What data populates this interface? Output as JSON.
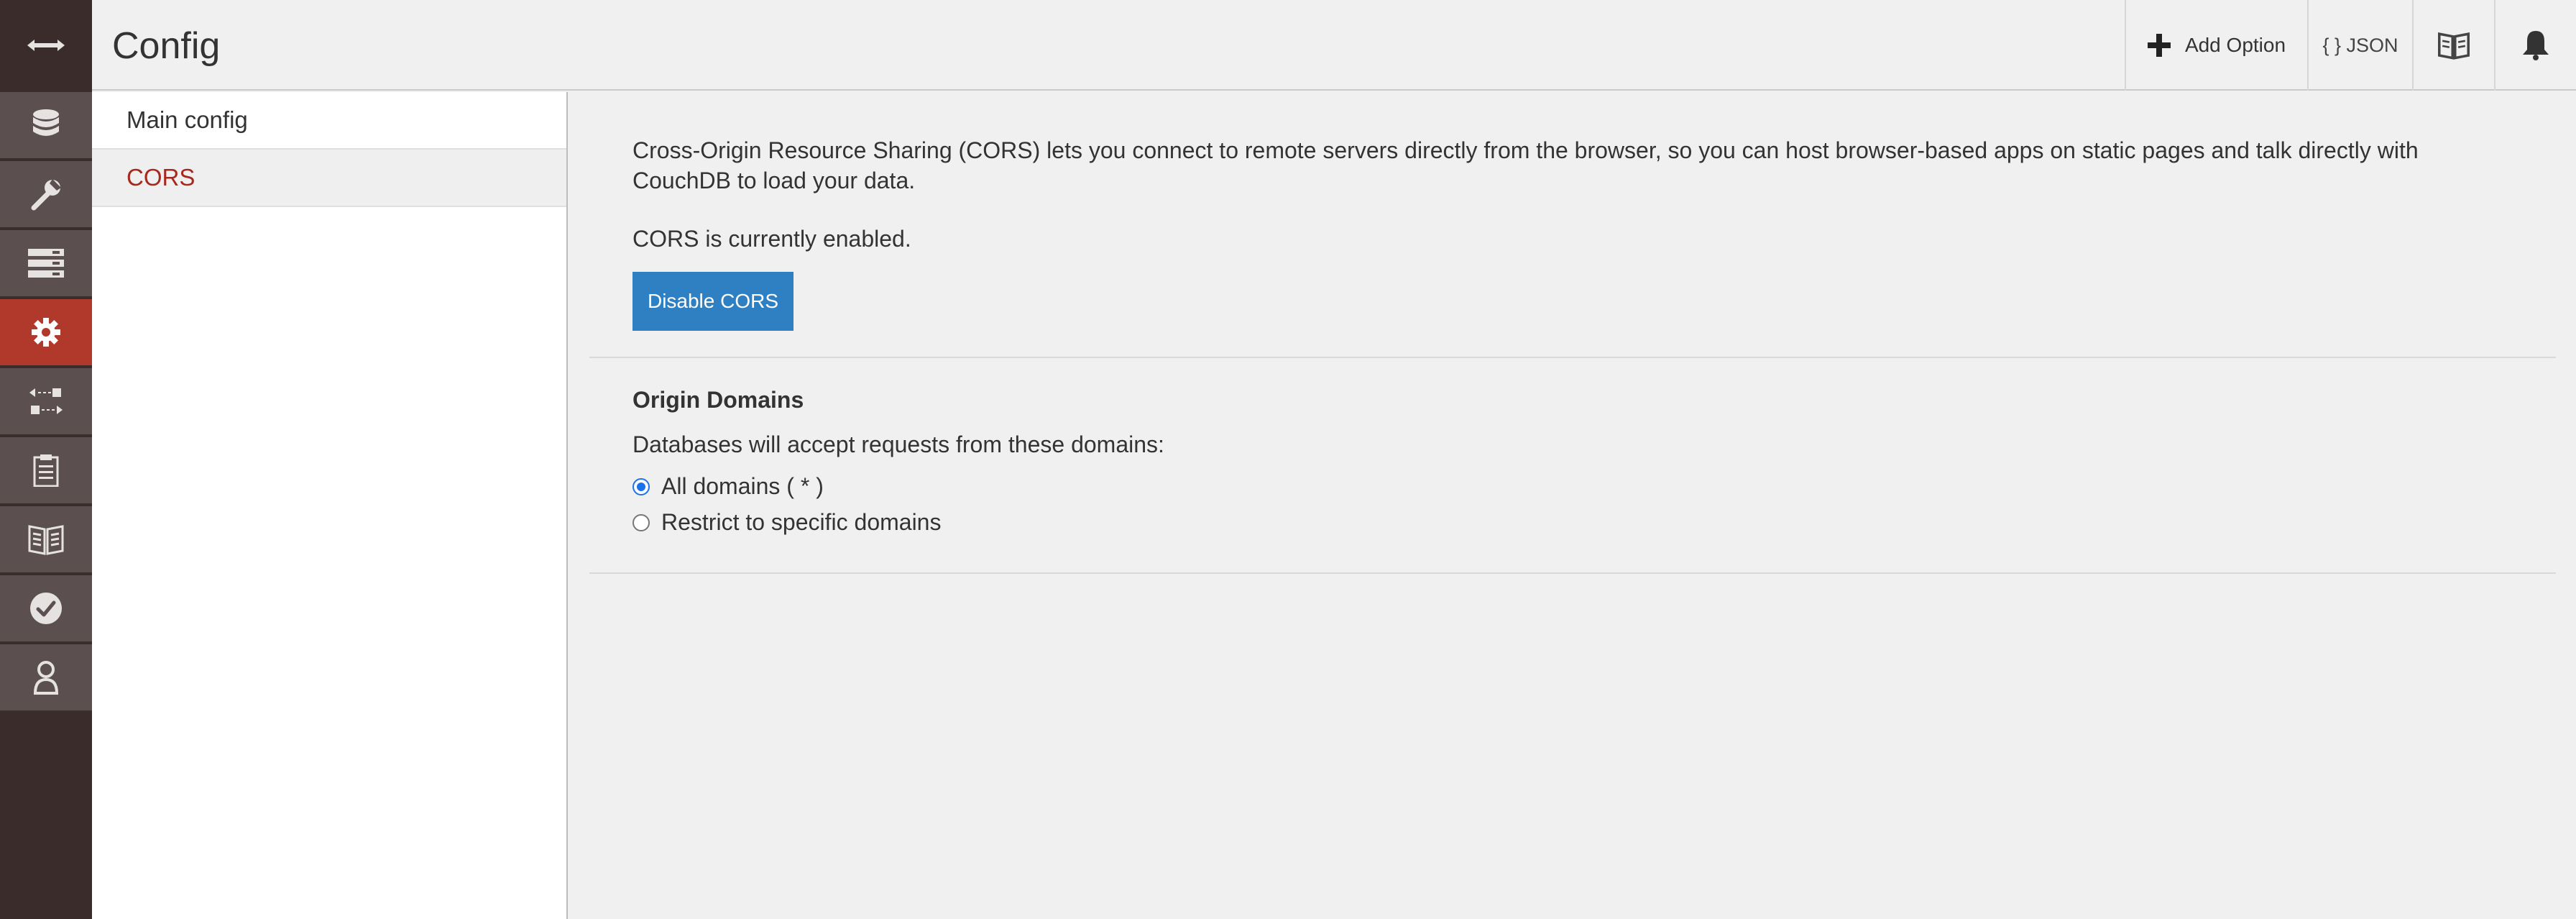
{
  "header": {
    "title": "Config",
    "add_option_label": "Add Option",
    "json_label": "{ } JSON"
  },
  "nav": {
    "toggle_icon": "arrows-horizontal-icon",
    "items": [
      {
        "icon": "database-icon"
      },
      {
        "icon": "wrench-icon"
      },
      {
        "icon": "server-icon"
      },
      {
        "icon": "gear-icon",
        "active": true
      },
      {
        "icon": "replication-icon"
      },
      {
        "icon": "clipboard-icon"
      },
      {
        "icon": "book-icon"
      },
      {
        "icon": "check-circle-icon"
      },
      {
        "icon": "user-icon"
      }
    ]
  },
  "sidebar": {
    "items": [
      {
        "label": "Main config"
      },
      {
        "label": "CORS",
        "active": true
      }
    ]
  },
  "main": {
    "intro_line1": "Cross-Origin Resource Sharing (CORS) lets you connect to remote servers directly from the browser, so you can host browser-based apps on static pages and talk directly with",
    "intro_line2": "CouchDB to load your data.",
    "status": "CORS is currently enabled.",
    "disable_button": "Disable CORS",
    "origin_title": "Origin Domains",
    "origin_desc": "Databases will accept requests from these domains:",
    "options": [
      {
        "label": "All domains ( * )",
        "checked": true
      },
      {
        "label": "Restrict to specific domains",
        "checked": false
      }
    ]
  },
  "colors": {
    "nav_bg": "#3a2c2b",
    "nav_item_bg": "#5b504f",
    "accent_red": "#b1392b",
    "button_blue": "#2f80c2"
  }
}
